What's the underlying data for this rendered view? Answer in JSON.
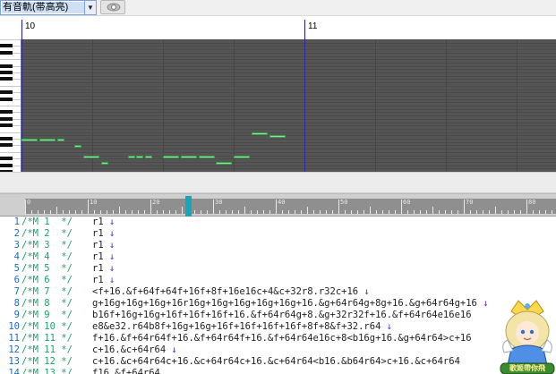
{
  "toolbar": {
    "track_selector": {
      "value": "有音軌(帯高亮)",
      "arrow": "▼"
    },
    "preview_button": {
      "icon": "eye-icon"
    }
  },
  "piano_roll": {
    "measures": [
      "10",
      "11"
    ],
    "note_color": "#8ee39a",
    "grid_color": "#555555",
    "notes": [
      {
        "start_beat": 0.0,
        "length_beats": 1.0,
        "pitch_row": 30
      },
      {
        "start_beat": 1.0,
        "length_beats": 1.0,
        "pitch_row": 30
      },
      {
        "start_beat": 2.0,
        "length_beats": 0.5,
        "pitch_row": 30
      },
      {
        "start_beat": 3.0,
        "length_beats": 0.5,
        "pitch_row": 32
      },
      {
        "start_beat": 3.5,
        "length_beats": 1.0,
        "pitch_row": 35
      },
      {
        "start_beat": 4.5,
        "length_beats": 0.5,
        "pitch_row": 37
      },
      {
        "start_beat": 6.0,
        "length_beats": 0.5,
        "pitch_row": 35
      },
      {
        "start_beat": 6.5,
        "length_beats": 0.5,
        "pitch_row": 35
      },
      {
        "start_beat": 7.0,
        "length_beats": 0.5,
        "pitch_row": 35
      },
      {
        "start_beat": 8.0,
        "length_beats": 1.0,
        "pitch_row": 35
      },
      {
        "start_beat": 9.0,
        "length_beats": 1.0,
        "pitch_row": 35
      },
      {
        "start_beat": 10.0,
        "length_beats": 1.0,
        "pitch_row": 35
      },
      {
        "start_beat": 11.0,
        "length_beats": 1.0,
        "pitch_row": 37
      },
      {
        "start_beat": 12.0,
        "length_beats": 1.0,
        "pitch_row": 35
      },
      {
        "start_beat": 13.0,
        "length_beats": 1.0,
        "pitch_row": 28
      },
      {
        "start_beat": 14.0,
        "length_beats": 1.0,
        "pitch_row": 29
      }
    ]
  },
  "editor_ruler": {
    "numbers": [
      "0",
      "10",
      "20",
      "30",
      "40",
      "50",
      "60",
      "70",
      "80",
      "90"
    ]
  },
  "editor": {
    "lines": [
      {
        "num": "1",
        "comment": "/*M 1  */",
        "code": "r1",
        "link": "↓"
      },
      {
        "num": "2",
        "comment": "/*M 2  */",
        "code": "r1",
        "link": "↓"
      },
      {
        "num": "3",
        "comment": "/*M 3  */",
        "code": "r1",
        "link": "↓"
      },
      {
        "num": "4",
        "comment": "/*M 4  */",
        "code": "r1",
        "link": "↓"
      },
      {
        "num": "5",
        "comment": "/*M 5  */",
        "code": "r1",
        "link": "↓"
      },
      {
        "num": "6",
        "comment": "/*M 6  */",
        "code": "r1",
        "link": "↓"
      },
      {
        "num": "7",
        "comment": "/*M 7  */",
        "code": "<f+16.&f+64f+64f+16f+8f+16e16c+4&c+32r8.r32c+16",
        "link": "↓"
      },
      {
        "num": "8",
        "comment": "/*M 8  */",
        "code": "g+16g+16g+16g+16r16g+16g+16g+16g+16g+16.&g+64r64g+8g+16.&g+64r64g+16",
        "link": "↓"
      },
      {
        "num": "9",
        "comment": "/*M 9  */",
        "code": "b16f+16g+16g+16f+16f+16f+16.&f+64r64g+8.&g+32r32f+16.&f+64r64e16e16",
        "link": ""
      },
      {
        "num": "10",
        "comment": "/*M 10 */",
        "code": "e8&e32.r64b8f+16g+16g+16f+16f+16f+16f+8f+8&f+32.r64",
        "link": "↓"
      },
      {
        "num": "11",
        "comment": "/*M 11 */",
        "code": "f+16.&f+64r64f+16.&f+64r64f+16.&f+64r64e16c+8<b16g+16.&g+64r64>c+16",
        "link": ""
      },
      {
        "num": "12",
        "comment": "/*M 11 */",
        "code": "c+16.&c+64r64",
        "link": "↓"
      },
      {
        "num": "13",
        "comment": "/*M 12 */",
        "code": "c+16.&c+64r64c+16.&c+64r64c+16.&c+64r64<b16.&b64r64>c+16.&c+64r64",
        "link": ""
      },
      {
        "num": "14",
        "comment": "/*M 13 */",
        "code": "f16.&f+64r64",
        "link": ""
      }
    ]
  },
  "badge": {
    "icon": "anime-character-badge-icon",
    "text": "歌姬帶你飛"
  }
}
